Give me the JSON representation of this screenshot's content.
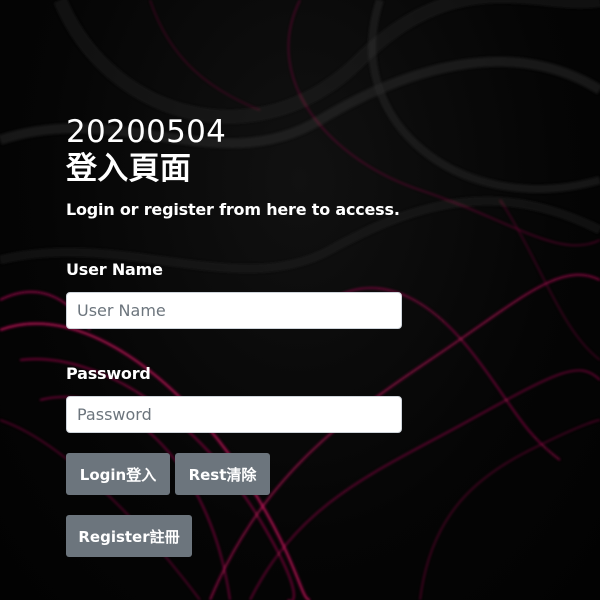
{
  "page": {
    "title_line1": "20200504",
    "title_line2": "登入頁面",
    "subtitle": "Login or register from here to access."
  },
  "form": {
    "username_label": "User Name",
    "username_placeholder": "User Name",
    "username_value": "",
    "password_label": "Password",
    "password_placeholder": "Password",
    "password_value": ""
  },
  "buttons": {
    "login": "Login登入",
    "reset": "Rest清除",
    "register": "Register註冊"
  },
  "colors": {
    "background": "#050505",
    "accent_lines": "#e0106a",
    "button_bg": "#6c757d",
    "text": "#ffffff"
  }
}
